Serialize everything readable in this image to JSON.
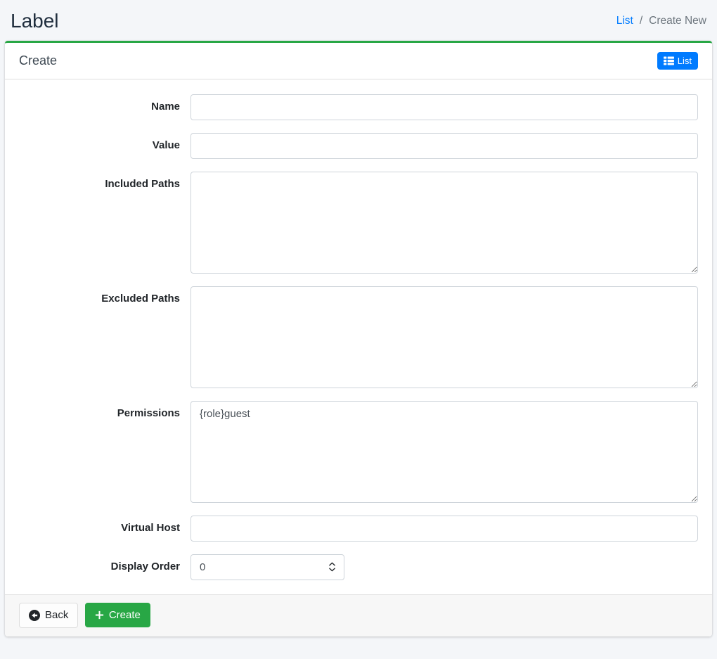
{
  "header": {
    "title": "Label",
    "breadcrumb": {
      "list_label": "List",
      "separator": "/",
      "current_label": "Create New"
    }
  },
  "card": {
    "title": "Create",
    "list_button": {
      "label": "List",
      "icon": "th-list-icon",
      "color": "#007bff"
    },
    "form": {
      "fields": [
        {
          "label": "Name",
          "type": "text",
          "value": ""
        },
        {
          "label": "Value",
          "type": "text",
          "value": ""
        },
        {
          "label": "Included Paths",
          "type": "textarea",
          "value": ""
        },
        {
          "label": "Excluded Paths",
          "type": "textarea",
          "value": ""
        },
        {
          "label": "Permissions",
          "type": "textarea",
          "value": "{role}guest"
        },
        {
          "label": "Virtual Host",
          "type": "text",
          "value": ""
        },
        {
          "label": "Display Order",
          "type": "number",
          "value": "0"
        }
      ]
    }
  },
  "footer": {
    "back_button": {
      "label": "Back",
      "icon": "arrow-circle-left-icon"
    },
    "create_button": {
      "label": "Create",
      "icon": "plus-icon",
      "color": "#28a745"
    }
  },
  "colors": {
    "page_background": "#f4f6f9",
    "card_accent_green": "#28a745",
    "link_blue": "#007bff",
    "muted_text": "#6c757d",
    "input_border": "#ced4da",
    "footer_background": "#f7f7f7"
  },
  "icons": {
    "th-list-icon": "grid-rows-glyph",
    "arrow-circle-left-icon": "filled-circle-left-arrow",
    "plus-icon": "plus-sign",
    "number-spinner-icon": "up-down-chevrons"
  }
}
